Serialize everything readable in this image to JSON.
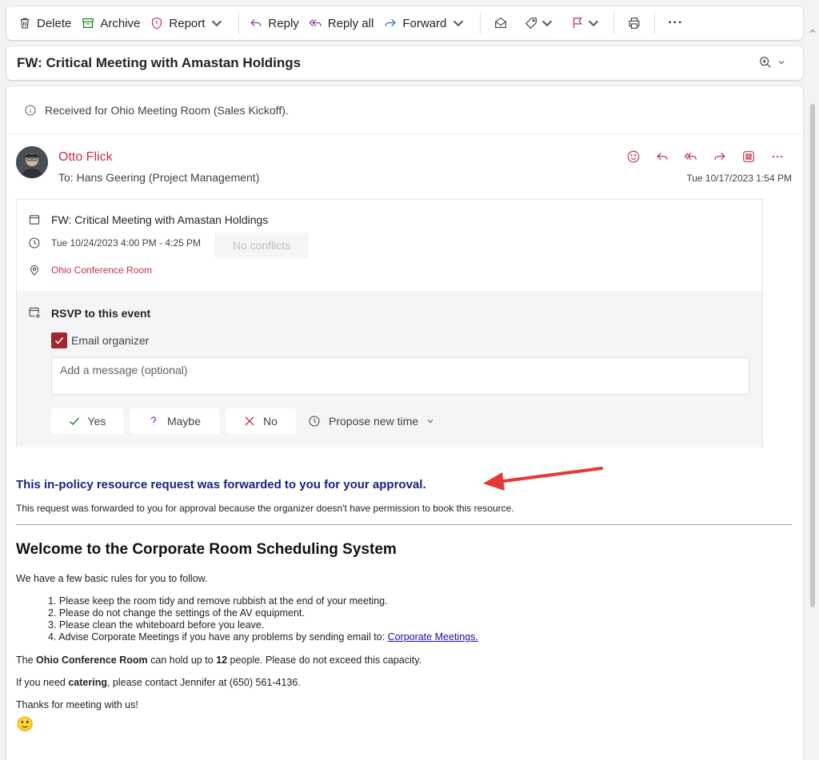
{
  "toolbar": {
    "delete_label": "Delete",
    "archive_label": "Archive",
    "report_label": "Report",
    "reply_label": "Reply",
    "reply_all_label": "Reply all",
    "forward_label": "Forward",
    "more_label": "···"
  },
  "subject": "FW: Critical Meeting with Amastan Holdings",
  "info_bar": "Received for Ohio Meeting Room (Sales Kickoff).",
  "sender": {
    "name": "Otto Flick",
    "to_prefix": "To:",
    "to": "Hans Geering (Project Management)",
    "date": "Tue 10/17/2023 1:54 PM"
  },
  "event": {
    "title": "FW: Critical Meeting with Amastan Holdings",
    "time": "Tue 10/24/2023 4:00 PM - 4:25 PM",
    "conflicts": "No conflicts",
    "location": "Ohio Conference Room"
  },
  "rsvp": {
    "title": "RSVP to this event",
    "email_organizer": "Email organizer",
    "email_organizer_checked": true,
    "message_placeholder": "Add a message (optional)",
    "yes": "Yes",
    "maybe": "Maybe",
    "no": "No",
    "propose": "Propose new time"
  },
  "body": {
    "approval_heading": "This in-policy resource request was forwarded to you for your approval.",
    "approval_text": "This request was forwarded to you for approval because the organizer doesn't have permission to book this resource.",
    "welcome": "Welcome to the Corporate Room Scheduling System",
    "intro": "We have a few basic rules for you to follow.",
    "rules": [
      "Please keep the room tidy and remove rubbish at the end of your meeting.",
      "Please do not change the settings of the AV equipment.",
      "Please clean the whiteboard before you leave.",
      "Advise Corporate Meetings if you have any problems by sending email to:"
    ],
    "rule_numbers": [
      "1.",
      "2.",
      "3.",
      "4."
    ],
    "link_text": "Corporate Meetings.",
    "capacity_pre": "The",
    "capacity_room": "Ohio Conference Room",
    "capacity_mid": "can hold up to",
    "capacity_num": "12",
    "capacity_post": "people. Please do not exceed this capacity.",
    "catering_pre": "If you need",
    "catering_word": "catering",
    "catering_post": ", please contact Jennifer at (650) 561-4136.",
    "thanks": "Thanks for meeting with us!",
    "smiley": "🙂"
  },
  "colors": {
    "accent": "#c4314b",
    "heading_blue": "#1a237e",
    "arrow": "#e53935",
    "checkbox": "#a4262c"
  }
}
